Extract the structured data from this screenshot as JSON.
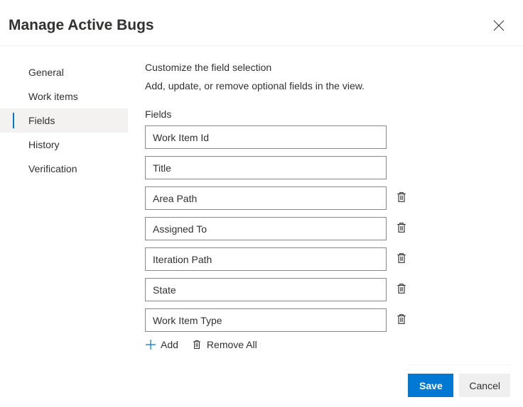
{
  "header": {
    "title": "Manage Active Bugs"
  },
  "sidebar": {
    "items": [
      {
        "label": "General",
        "selected": false
      },
      {
        "label": "Work items",
        "selected": false
      },
      {
        "label": "Fields",
        "selected": true
      },
      {
        "label": "History",
        "selected": false
      },
      {
        "label": "Verification",
        "selected": false
      }
    ]
  },
  "main": {
    "heading": "Customize the field selection",
    "description": "Add, update, or remove optional fields in the view.",
    "fields_label": "Fields",
    "fields": [
      {
        "value": "Work Item Id",
        "deletable": false
      },
      {
        "value": "Title",
        "deletable": false
      },
      {
        "value": "Area Path",
        "deletable": true
      },
      {
        "value": "Assigned To",
        "deletable": true
      },
      {
        "value": "Iteration Path",
        "deletable": true
      },
      {
        "value": "State",
        "deletable": true
      },
      {
        "value": "Work Item Type",
        "deletable": true
      }
    ],
    "add_label": "Add",
    "remove_all_label": "Remove All"
  },
  "footer": {
    "save_label": "Save",
    "cancel_label": "Cancel"
  }
}
